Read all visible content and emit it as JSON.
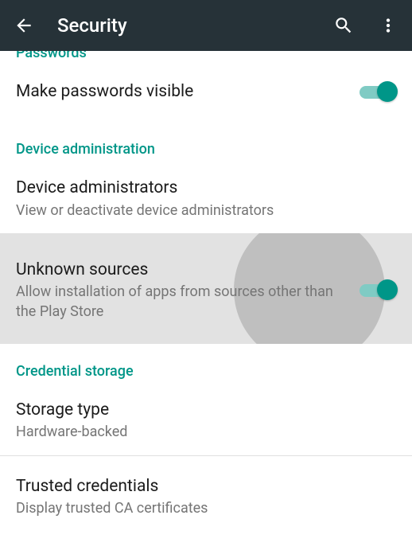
{
  "appbar": {
    "title": "Security"
  },
  "sections": {
    "passwords": {
      "header": "Passwords",
      "make_visible": {
        "title": "Make passwords visible",
        "enabled": true
      }
    },
    "device_admin": {
      "header": "Device administration",
      "administrators": {
        "title": "Device administrators",
        "sub": "View or deactivate device administrators"
      },
      "unknown_sources": {
        "title": "Unknown sources",
        "sub": "Allow installation of apps from sources other than the Play Store",
        "enabled": true
      }
    },
    "credential_storage": {
      "header": "Credential storage",
      "storage_type": {
        "title": "Storage type",
        "sub": "Hardware-backed"
      },
      "trusted_credentials": {
        "title": "Trusted credentials",
        "sub": "Display trusted CA certificates"
      }
    }
  },
  "colors": {
    "accent": "#009688"
  }
}
